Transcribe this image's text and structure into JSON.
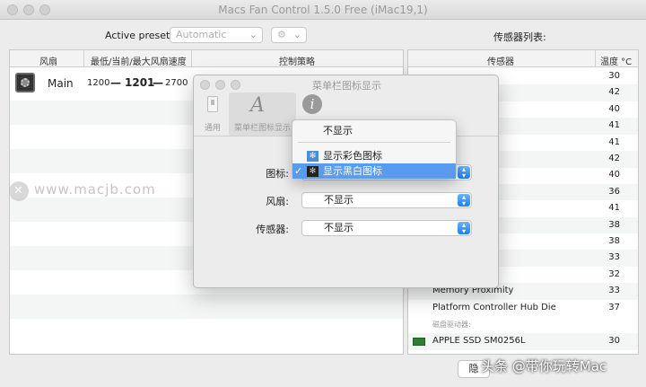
{
  "window": {
    "title": "Macs Fan Control 1.5.0 Free (iMac19,1)"
  },
  "toolbar": {
    "preset_label": "Active preset:",
    "preset_value": "Automatic",
    "sensors_label": "传感器列表:"
  },
  "fans_table": {
    "columns": [
      "风扇",
      "最低/当前/最大风扇速度",
      "控制策略"
    ],
    "rows": [
      {
        "name": "Main",
        "min": "1200",
        "current": "1201",
        "max": "2700",
        "dash": "—"
      }
    ]
  },
  "sensors_table": {
    "columns": [
      "传感器",
      "温度 °C"
    ],
    "rows": [
      {
        "name": "",
        "value": "30"
      },
      {
        "name": "",
        "value": "42"
      },
      {
        "name": "",
        "value": "40"
      },
      {
        "name": "",
        "value": "41"
      },
      {
        "name": "",
        "value": "41"
      },
      {
        "name": "",
        "value": "42"
      },
      {
        "name": "",
        "value": "40"
      },
      {
        "name": "",
        "value": "36"
      },
      {
        "name": "",
        "value": "41"
      },
      {
        "name": "",
        "value": "38"
      },
      {
        "name": "",
        "value": "38"
      },
      {
        "name": "",
        "value": "33"
      },
      {
        "name": "",
        "value": "32"
      },
      {
        "name": "Memory Proximity",
        "value": "33"
      },
      {
        "name": "Platform Controller Hub Die",
        "value": "37"
      }
    ],
    "disk_group_label": "磁盘驱动器:",
    "disk_row": {
      "name": "APPLE SSD SM0256L",
      "value": "30"
    }
  },
  "dialog": {
    "title": "菜单栏图标显示",
    "tabs": [
      {
        "label": "通用"
      },
      {
        "label": "菜单栏图标显示"
      },
      {
        "label": ""
      }
    ],
    "fields": {
      "icon_label": "图标:",
      "fan_label": "风扇:",
      "fan_value": "不显示",
      "sensor_label": "传感器:",
      "sensor_value": "不显示"
    },
    "menu": {
      "items": [
        "不显示",
        "显示彩色图标",
        "显示黑白图标"
      ],
      "selected_index": 2
    }
  },
  "footer": {
    "button_label": "隐"
  },
  "watermarks": {
    "site": "www.macjb.com",
    "credit": "头条 @带你玩转Mac"
  },
  "colors": {
    "selection": "#5a9bf0",
    "accent": "#1a7ff0"
  }
}
